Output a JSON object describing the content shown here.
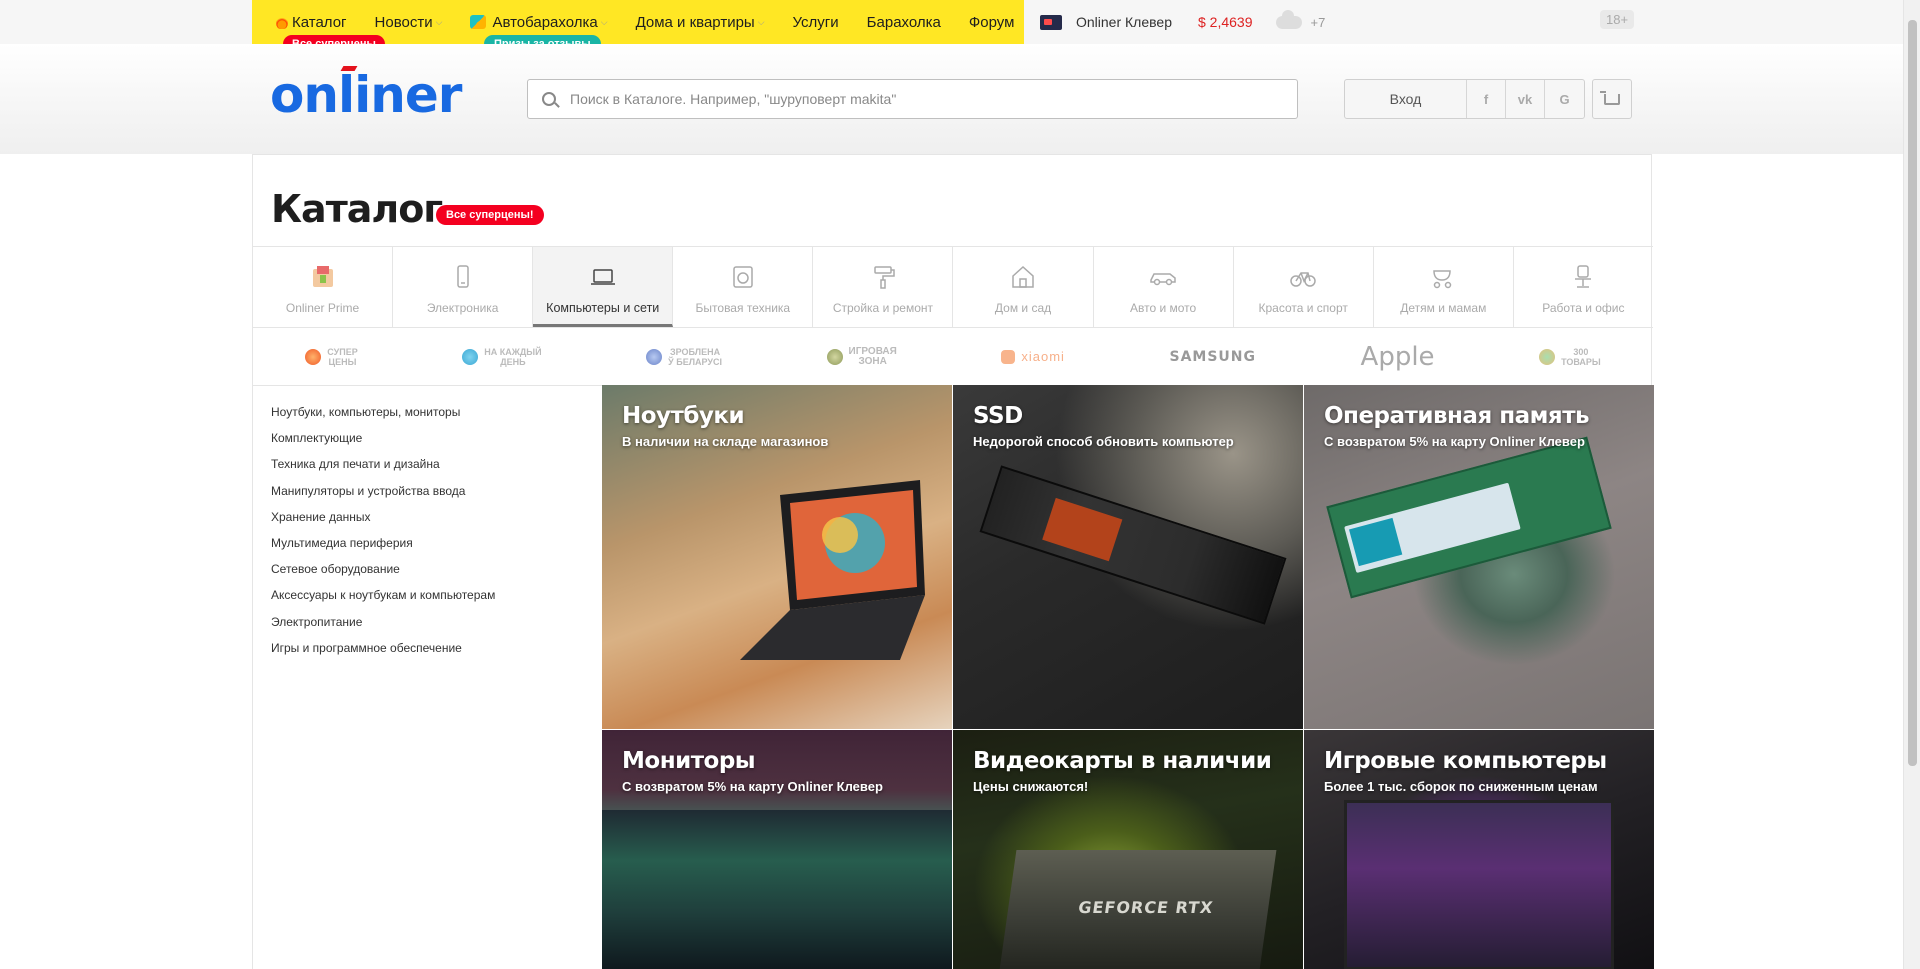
{
  "topnav": {
    "items": [
      {
        "label": "Каталог",
        "icon": "fire-icon",
        "badge": "Все суперцены"
      },
      {
        "label": "Новости",
        "chevron": true
      },
      {
        "label": "Автобарахолка",
        "icon": "flag-icon",
        "chevron": true,
        "badge": "Призы за отзывы"
      },
      {
        "label": "Дома и квартиры",
        "chevron": true
      },
      {
        "label": "Услуги"
      },
      {
        "label": "Барахолка"
      },
      {
        "label": "Форум"
      }
    ],
    "klever_label": "Onliner Клевер",
    "currency": "$ 2,4639",
    "temperature": "+7",
    "age_badge": "18+",
    "colors": {
      "bar": "#ffe724",
      "badge_red": "#f40020",
      "badge_teal": "#1ab5a5"
    }
  },
  "header": {
    "logo": "onliner",
    "search_placeholder": "Поиск в Каталоге. Например, \"шуруповерт makita\"",
    "login_label": "Вход",
    "social": [
      "f",
      "vk",
      "G"
    ],
    "cart_icon": "cart-icon"
  },
  "page": {
    "title": "Каталог",
    "title_badge": "Все суперцены!"
  },
  "tabs": [
    {
      "label": "Onliner Prime",
      "icon": "prime-icon",
      "active": false
    },
    {
      "label": "Электроника",
      "icon": "phone-icon",
      "active": false
    },
    {
      "label": "Компьютеры и сети",
      "icon": "laptop-icon",
      "active": true
    },
    {
      "label": "Бытовая техника",
      "icon": "washer-icon",
      "active": false
    },
    {
      "label": "Стройка и ремонт",
      "icon": "roller-icon",
      "active": false
    },
    {
      "label": "Дом и сад",
      "icon": "house-icon",
      "active": false
    },
    {
      "label": "Авто и мото",
      "icon": "car-icon",
      "active": false
    },
    {
      "label": "Красота и спорт",
      "icon": "bicycle-icon",
      "active": false
    },
    {
      "label": "Детям и мамам",
      "icon": "stroller-icon",
      "active": false
    },
    {
      "label": "Работа и офис",
      "icon": "chair-icon",
      "active": false
    }
  ],
  "brands": [
    {
      "line1": "СУПЕР",
      "line2": "ЦЕНЫ",
      "icon": "flame-icon"
    },
    {
      "line1": "НА КАЖДЫЙ",
      "line2": "ДЕНЬ",
      "icon": "cart-promo-icon"
    },
    {
      "line1": "ЗРОБЛЕНА",
      "line2": "Ў БЕЛАРУСІ",
      "icon": "ornament-icon"
    },
    {
      "line1": "ИГРОВАЯ",
      "line2": "ЗОНА",
      "icon": "gamepad-icon"
    },
    {
      "label": "xiaomi"
    },
    {
      "label": "SAMSUNG"
    },
    {
      "label": "Apple"
    },
    {
      "line1": "300",
      "line2": "ТОВАРЫ",
      "icon": "box-icon"
    }
  ],
  "sidemenu": [
    "Ноутбуки, компьютеры, мониторы",
    "Комплектующие",
    "Техника для печати и дизайна",
    "Манипуляторы и устройства ввода",
    "Хранение данных",
    "Мультимедиа периферия",
    "Сетевое оборудование",
    "Аксессуары к ноутбукам и компьютерам",
    "Электропитание",
    "Игры и программное обеспечение"
  ],
  "tiles": [
    {
      "title": "Ноутбуки",
      "subtitle": "В наличии на складе магазинов"
    },
    {
      "title": "SSD",
      "subtitle": "Недорогой способ обновить компьютер"
    },
    {
      "title": "Оперативная память",
      "subtitle": "С возвратом 5% на карту Onliner Клевер"
    },
    {
      "title": "Мониторы",
      "subtitle": "С возвратом 5% на карту Onliner Клевер"
    },
    {
      "title": "Видеокарты в наличии",
      "subtitle": "Цены снижаются!"
    },
    {
      "title": "Игровые компьютеры",
      "subtitle": "Более 1 тыс. сборок по сниженным ценам"
    }
  ],
  "tile_graphics": {
    "gpu_text": "GEFORCE RTX"
  }
}
